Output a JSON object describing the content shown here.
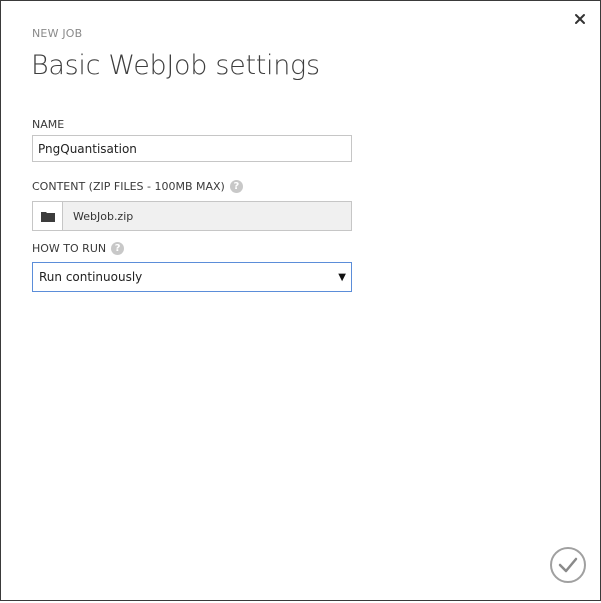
{
  "dialog": {
    "eyebrow": "NEW JOB",
    "title": "Basic WebJob settings"
  },
  "form": {
    "name_label": "NAME",
    "name_value": "PngQuantisation",
    "content_label": "CONTENT (ZIP FILES - 100MB MAX)",
    "content_file": "WebJob.zip",
    "how_to_run_label": "HOW TO RUN",
    "how_to_run_value": "Run continuously"
  },
  "icons": {
    "close": "close-icon",
    "help": "help-icon",
    "folder": "folder-icon",
    "dropdown": "dropdown-arrow-icon",
    "confirm": "checkmark-icon"
  },
  "colors": {
    "accent_border": "#5b8dd9",
    "muted_text": "#8a8a8a",
    "title_text": "#3e3e3e"
  }
}
